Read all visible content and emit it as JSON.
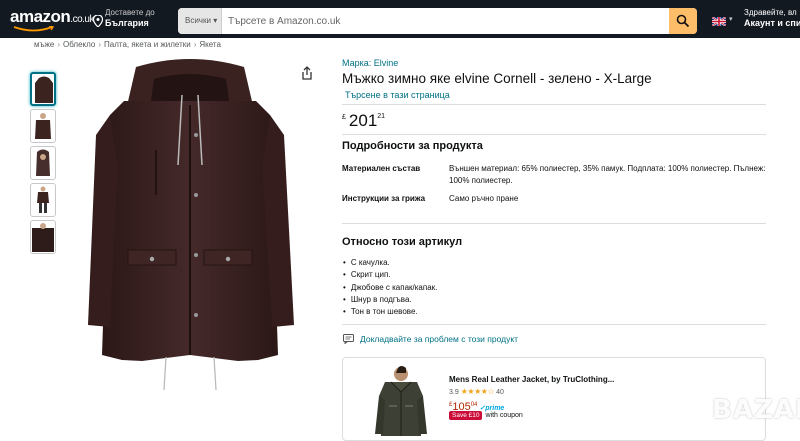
{
  "header": {
    "logo": "amazon",
    "logo_tld": ".co.uk",
    "deliver_line1": "Доставете до",
    "deliver_line2": "България",
    "search_dept": "Всички",
    "search_placeholder": "Търсете в Amazon.co.uk",
    "language_flag": "uk-flag-icon",
    "account_line1": "Здравейте, вл",
    "account_line2": "Акаунт и спи"
  },
  "breadcrumb": [
    "мъже",
    "Облекло",
    "Палта, якета и жилетки",
    "Якета"
  ],
  "thumbnails": [
    {
      "icon": "jacket-front-thumbnail"
    },
    {
      "icon": "jacket-model-thumbnail"
    },
    {
      "icon": "jacket-hood-thumbnail"
    },
    {
      "icon": "jacket-fullbody-thumbnail"
    },
    {
      "icon": "jacket-detail-thumbnail"
    }
  ],
  "product": {
    "brand": "Марка: Elvine",
    "title": "Мъжко зимно яке elvine Cornell - зелено - X-Large",
    "store_link": "Търсене в тази страница",
    "price_symbol": "£",
    "price_whole": "201",
    "price_fraction": "21",
    "color_jacket": "#3b2320"
  },
  "details": {
    "heading": "Подробности за продукта",
    "rows": [
      {
        "label": "Материален състав",
        "value": "Външен материал: 65% полиестер, 35% памук. Подплата: 100% полиестер. Пълнеж: 100% полиестер."
      },
      {
        "label": "Инструкции за грижа",
        "value": "Само ръчно пране"
      }
    ]
  },
  "about": {
    "heading": "Относно този артикул",
    "bullets": [
      "С качулка.",
      "Скрит цип.",
      "Джобове с капак/капак.",
      "Шнур в подгъва.",
      "Тон в тон шевове."
    ]
  },
  "report": {
    "label": "Докладвайте за проблем с този продукт"
  },
  "sponsored": {
    "title": "Mens Real Leather Jacket, by TruClothing...",
    "rating": "3.9",
    "stars": "★★★★☆",
    "reviews": "40",
    "price_symbol": "£",
    "price_whole": "105",
    "price_fraction": "04",
    "prime": "✓prime",
    "coupon_badge": "Save £10",
    "coupon_text": "with coupon"
  },
  "watermark": "BAZAR"
}
